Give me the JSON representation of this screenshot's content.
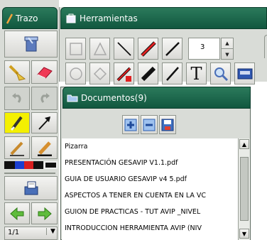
{
  "trazo_panel": {
    "title": "Trazo",
    "page_indicator": "1/1",
    "colors": [
      "#111111",
      "#1a3fd0",
      "#d81e1e",
      "#111111"
    ]
  },
  "tools_panel": {
    "title": "Herramientas",
    "line_width": "3"
  },
  "documents_panel": {
    "title": "Documentos(9)",
    "items": [
      "Pizarra",
      "PRESENTACIÓN GESAVIP V1.1.pdf",
      "GUIA DE USUARIO GESAVIP v4 5.pdf",
      "ASPECTOS A TENER EN CUENTA EN LA VC",
      "GUION DE PRACTICAS - TUT AVIP _NIVEL",
      "INTRODUCCION HERRAMIENTA AVIP (NIV"
    ]
  },
  "icons": [
    "pencil-icon",
    "clear-icon",
    "paintbrush-icon",
    "eraser-icon",
    "undo-icon",
    "redo-icon",
    "highlighter-icon",
    "arrow-icon",
    "pen-icon",
    "marker-icon",
    "open-file-icon",
    "previous-page-icon",
    "next-page-icon",
    "rectangle-icon",
    "triangle-icon",
    "line-icon",
    "red-line-icon",
    "line-icon-2",
    "ellipse-icon",
    "diamond-icon",
    "delete-line-icon",
    "thick-marker-icon",
    "thin-line-icon",
    "text-icon",
    "zoom-icon",
    "projector-icon",
    "add-icon",
    "remove-icon",
    "save-icon",
    "folder-icon"
  ]
}
